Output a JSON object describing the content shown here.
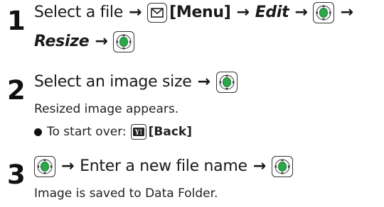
{
  "steps": [
    {
      "number": "1",
      "line1": {
        "text_a": "Select a file",
        "menu_label": "[Menu]",
        "edit_label": "Edit"
      },
      "line2": {
        "resize_label": "Resize"
      }
    },
    {
      "number": "2",
      "line1": {
        "text_a": "Select an image size"
      },
      "note": "Resized image appears.",
      "bullet": {
        "text": "To start over:",
        "back_label": "[Back]"
      }
    },
    {
      "number": "3",
      "line1": {
        "text_a": "Enter a new file name"
      },
      "note": "Image is saved to Data Folder."
    }
  ],
  "icons": {
    "center_key": "center-select-key-icon",
    "menu_key": "mail-menu-key-icon",
    "back_key": "yahoo-back-key-icon",
    "arrow": "right-arrow-icon"
  },
  "colors": {
    "key_green": "#2aa84a",
    "key_green_dark": "#1c7a33",
    "text": "#1a1a1a"
  }
}
